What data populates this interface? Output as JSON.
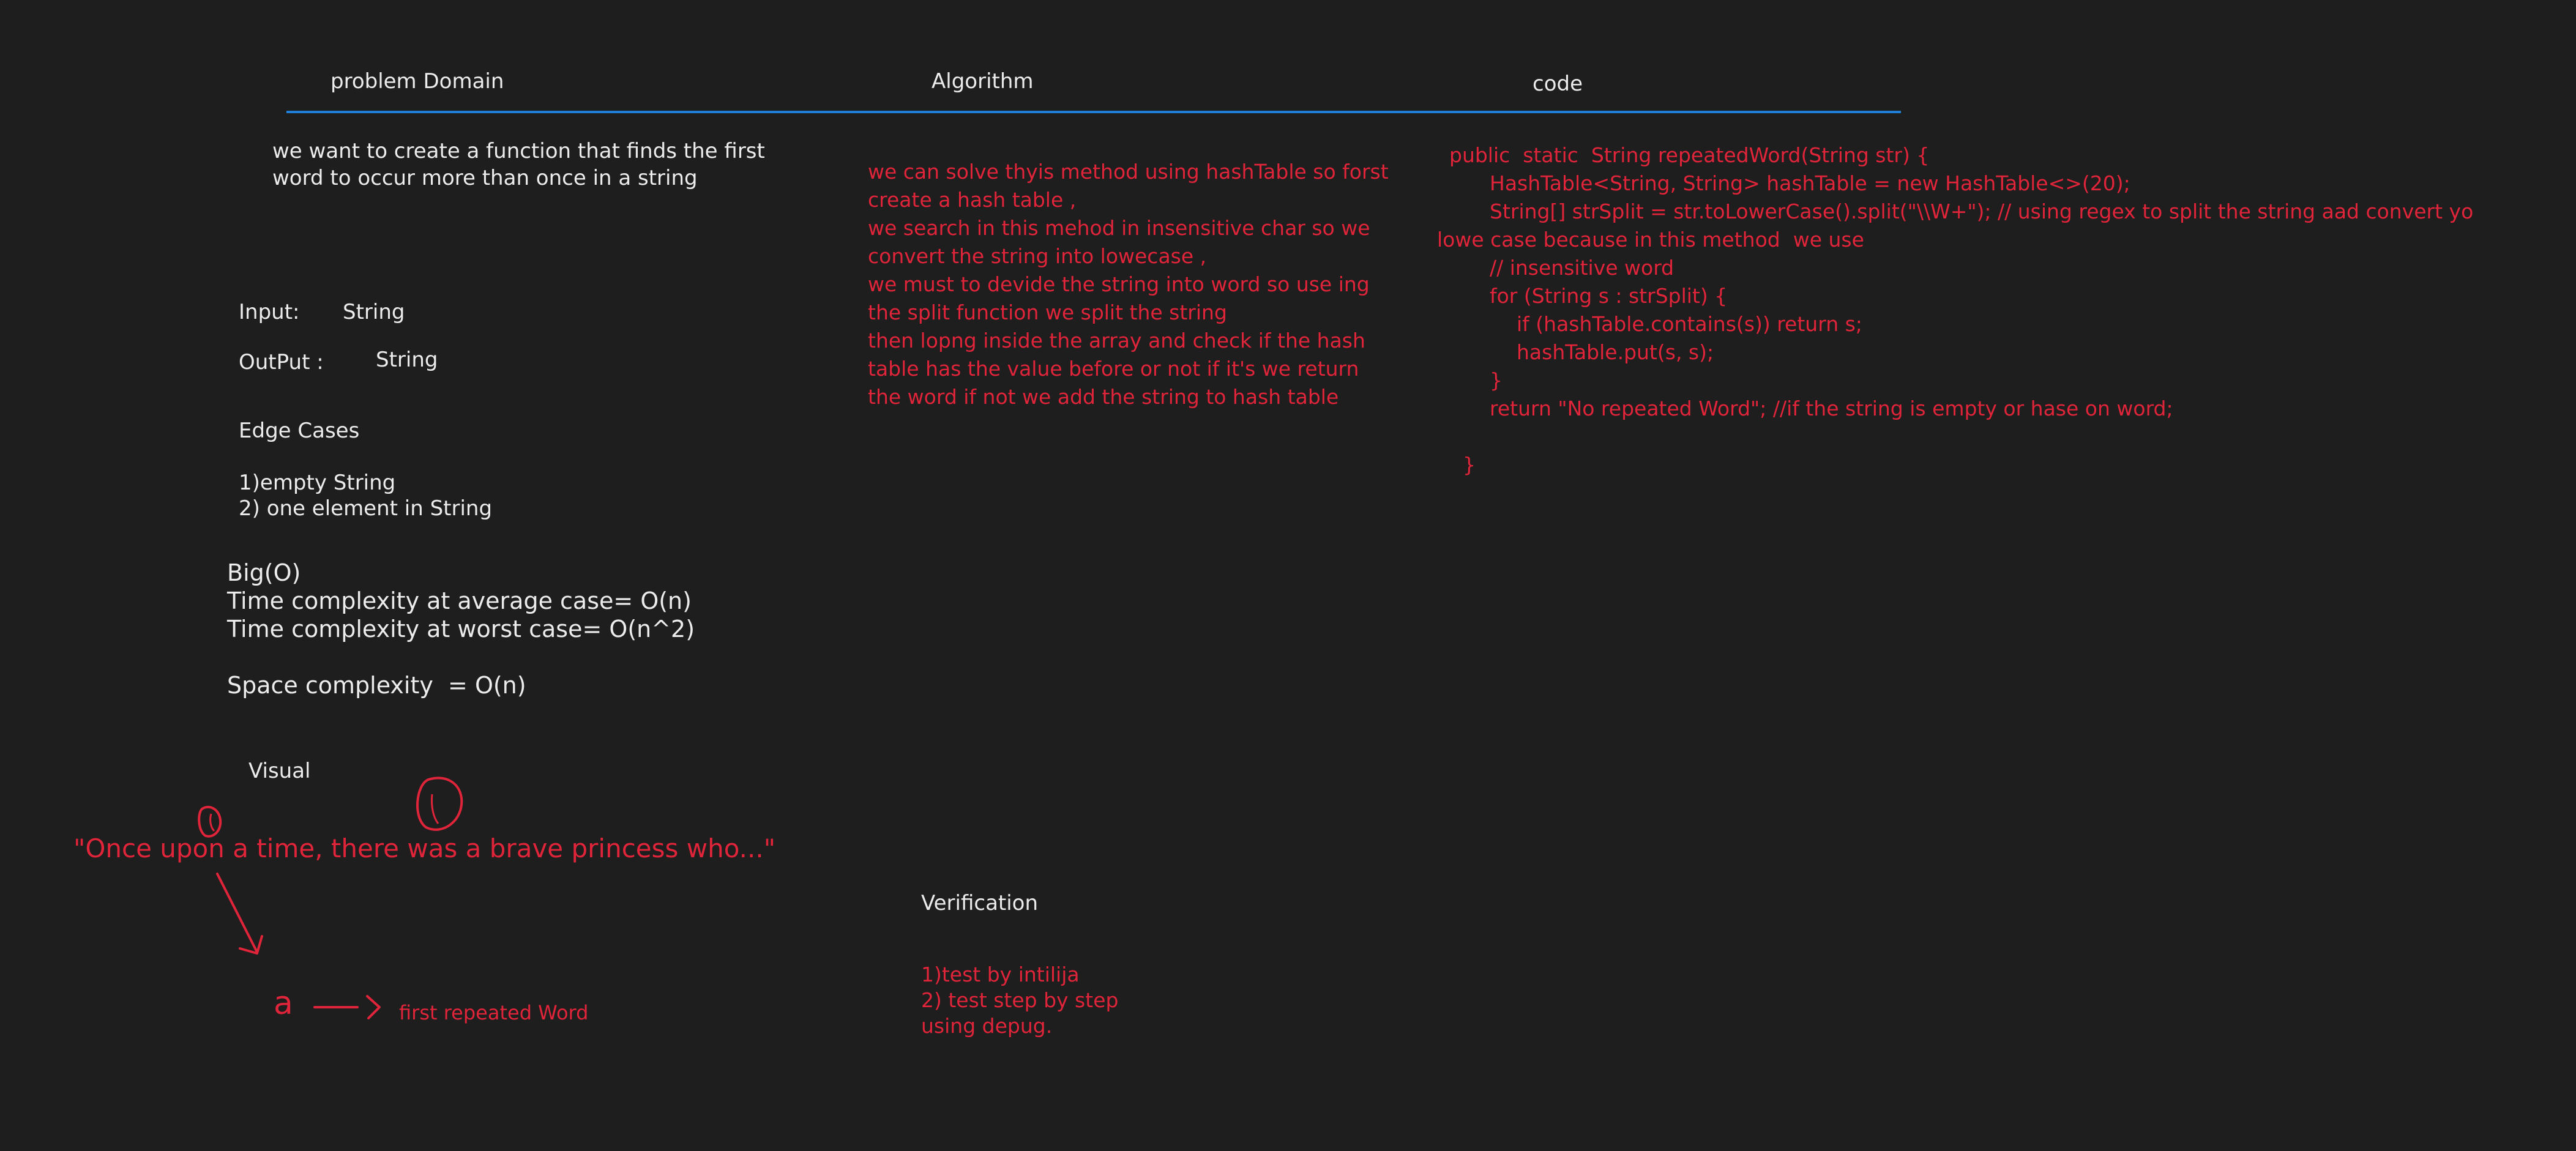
{
  "headers": {
    "problem_domain": "problem Domain",
    "algorithm": "Algorithm",
    "code": "code"
  },
  "problem": {
    "description_lines": [
      "we want to create a function that finds the first",
      "word to occur more than once in a string"
    ],
    "input_label": "Input:",
    "input_value": "String",
    "output_label": "OutPut :",
    "output_value": "String",
    "edge_cases_title": "Edge Cases",
    "edge_cases": [
      "1)empty String",
      "2) one element in String"
    ],
    "big_o_title": "Big(O)",
    "avg_case": "Time complexity at average case= O(n)",
    "worst_case": "Time complexity at worst case= O(n^2)",
    "space": "Space complexity  = O(n)",
    "visual_title": "Visual",
    "visual_quote": "\"Once upon a time, there was a brave princess who...\"",
    "visual_result_letter": "a",
    "visual_result_label": "first repeated Word"
  },
  "algorithm": {
    "lines": [
      "we can solve thyis method using hashTable so forst",
      "create a hash table ,",
      "we search in this mehod in insensitive char so we",
      "convert the string into lowecase ,",
      "we must to devide the string into word so use ing",
      "the split function we split the string",
      "then lopng inside the array and check if the hash",
      "table has the value before or not if it's we return",
      "the word if not we add the string to hash table"
    ]
  },
  "verification": {
    "title": "Verification",
    "lines": [
      "1)test by intilija",
      "2) test step by step",
      "using depug."
    ]
  },
  "code": {
    "lines": [
      "public  static  String repeatedWord(String str) {",
      "HashTable<String, String> hashTable = new HashTable<>(20);",
      "String[] strSplit = str.toLowerCase().split(\"\\\\W+\"); // using regex to split the string aad convert yo",
      "lowe case because in this method  we use",
      "// insensitive word",
      "for (String s : strSplit) {",
      "if (hashTable.contains(s)) return s;",
      "hashTable.put(s, s);",
      "}",
      "return \"No repeated Word\"; //if the string is empty or hase on word;",
      "}"
    ]
  },
  "colors": {
    "background": "#1e1e1e",
    "white_text": "#ececec",
    "red_ink": "#e0243a",
    "divider": "#1f7fd6"
  }
}
